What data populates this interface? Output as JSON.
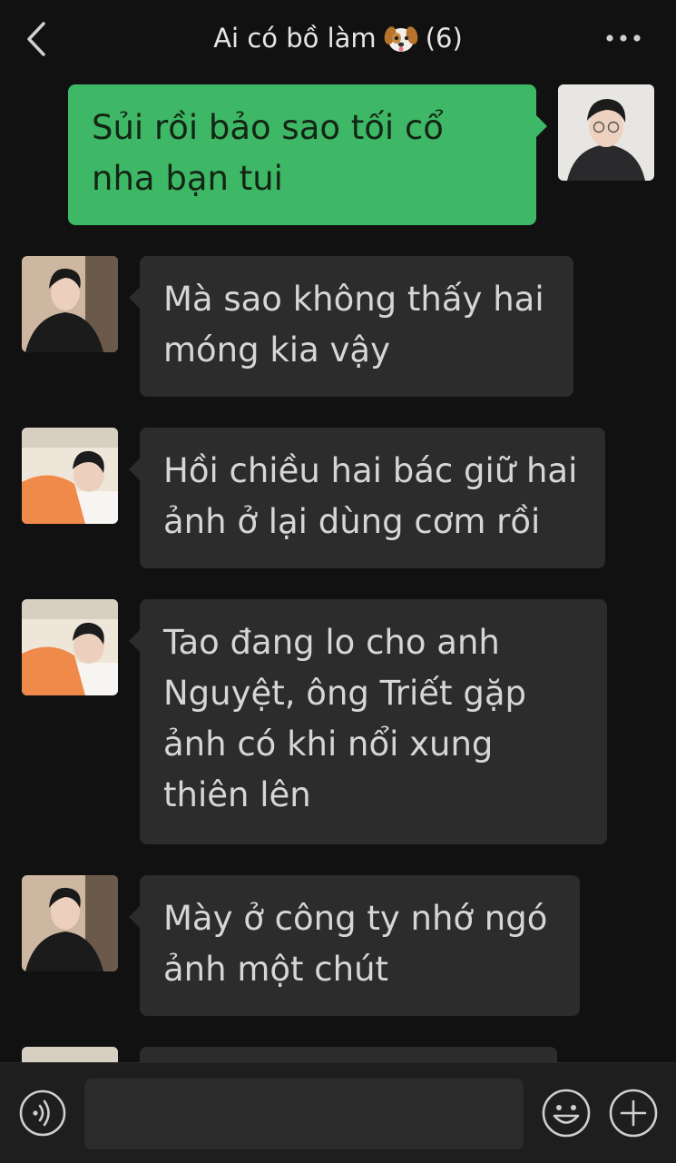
{
  "header": {
    "title": "Ai có bồ làm",
    "title_count": "(6)",
    "back_icon": "chevron-left-icon",
    "more_icon": "more-dots-icon"
  },
  "messages": [
    {
      "side": "right",
      "avatar": "avatar-man-glasses",
      "text": "Sủi rồi bảo sao tối cổ nha bạn tui"
    },
    {
      "side": "left",
      "avatar": "avatar-man-black-shirt",
      "text": "Mà sao không thấy hai móng kia vậy"
    },
    {
      "side": "left",
      "avatar": "avatar-man-orange-shirt",
      "text": "Hồi chiều hai bác giữ hai ảnh ở lại dùng cơm rồi"
    },
    {
      "side": "left",
      "avatar": "avatar-man-orange-shirt",
      "text": "Tao đang lo cho anh Nguyệt, ông Triết gặp ảnh có khi nổi xung thiên lên"
    },
    {
      "side": "left",
      "avatar": "avatar-man-black-shirt",
      "text": "Mày ở công ty nhớ ngó ảnh một chút"
    },
    {
      "side": "left",
      "avatar": "avatar-man-orange-shirt",
      "text": ""
    }
  ],
  "input_bar": {
    "value": "",
    "voice_icon": "voice-icon",
    "emoji_icon": "emoji-icon",
    "plus_icon": "plus-icon"
  },
  "colors": {
    "background": "#111111",
    "bubble_outgoing": "#3eb867",
    "bubble_incoming": "#2c2c2c"
  }
}
